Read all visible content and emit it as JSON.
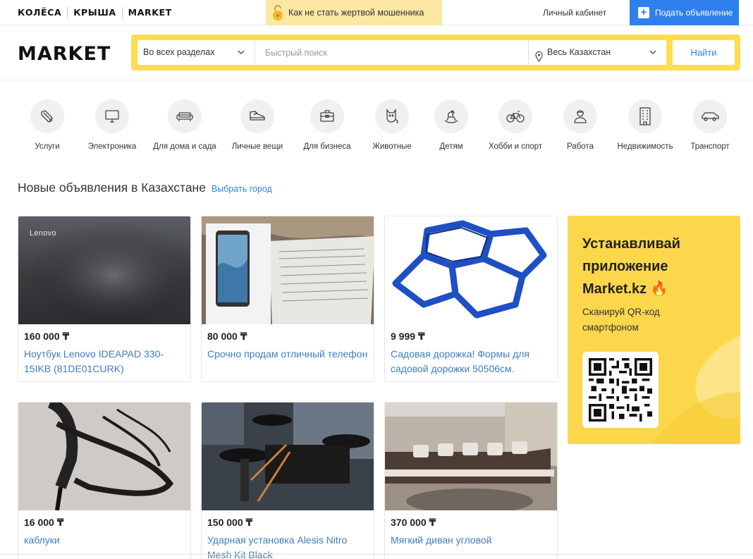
{
  "topbar": {
    "brands": [
      "КОЛЁСА",
      "КРЫША",
      "MARKET"
    ],
    "fraud_text": "Как не стать жертвой мошенника",
    "cabinet": "Личный кабинет",
    "post_ad": "Подать объявление"
  },
  "header": {
    "logo": "MARKET",
    "section_select": "Во всех разделах",
    "search_placeholder": "Быстрый поиск",
    "region_select": "Весь Казахстан",
    "find_button": "Найти"
  },
  "categories": [
    {
      "label": "Услуги",
      "icon": "wrench-icon"
    },
    {
      "label": "Электроника",
      "icon": "monitor-icon"
    },
    {
      "label": "Для дома и сада",
      "icon": "sofa-icon"
    },
    {
      "label": "Личные вещи",
      "icon": "sneaker-icon"
    },
    {
      "label": "Для бизнеса",
      "icon": "briefcase-icon"
    },
    {
      "label": "Животные",
      "icon": "cat-icon"
    },
    {
      "label": "Детям",
      "icon": "rocking-horse-icon"
    },
    {
      "label": "Хобби и спорт",
      "icon": "bicycle-icon"
    },
    {
      "label": "Работа",
      "icon": "worker-icon"
    },
    {
      "label": "Недвижимость",
      "icon": "building-icon"
    },
    {
      "label": "Транспорт",
      "icon": "car-icon"
    }
  ],
  "section": {
    "title": "Новые объявления в Казахстане",
    "choose_city": "Выбрать город"
  },
  "listings": [
    {
      "price": "160 000 ₸",
      "title": "Ноутбук Lenovo IDEAPAD 330-15IKB (81DE01CURK)",
      "image_text": "Lenovo"
    },
    {
      "price": "80 000 ₸",
      "title": "Срочно продам отличный телефон"
    },
    {
      "price": "9 999 ₸",
      "title": "Садовая дорожка! Формы для садовой дорожки 50506см."
    },
    {
      "price": "16 000 ₸",
      "title": "каблуки"
    },
    {
      "price": "150 000 ₸",
      "title": "Ударная установка Alesis Nitro Mesh Kit Black"
    },
    {
      "price": "370 000 ₸",
      "title": "Мягкий диван угловой"
    }
  ],
  "promo": {
    "heading": "Устанавливай приложение Market.kz 🔥",
    "subtext": "Сканируй QR-код смартфоном"
  },
  "colors": {
    "accent_blue": "#2f80ed",
    "search_yellow": "#fedd4e",
    "promo_yellow": "#fcd74c",
    "link_blue": "#3f7dc3"
  }
}
